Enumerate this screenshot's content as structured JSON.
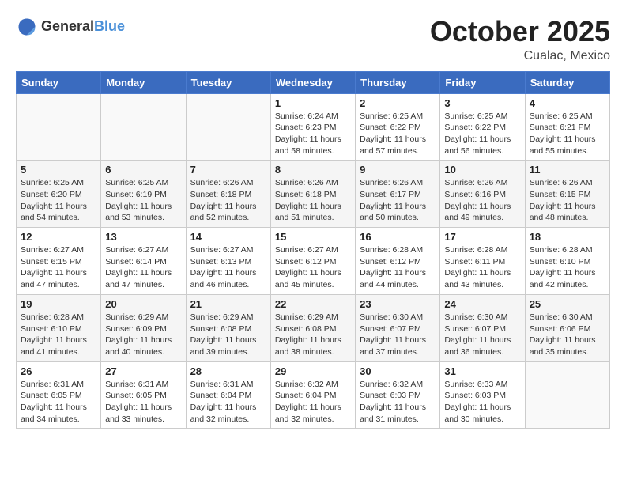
{
  "logo": {
    "text_general": "General",
    "text_blue": "Blue"
  },
  "title": {
    "month_year": "October 2025",
    "location": "Cualac, Mexico"
  },
  "weekdays": [
    "Sunday",
    "Monday",
    "Tuesday",
    "Wednesday",
    "Thursday",
    "Friday",
    "Saturday"
  ],
  "weeks": [
    [
      {
        "day": "",
        "sunrise": "",
        "sunset": "",
        "daylight": ""
      },
      {
        "day": "",
        "sunrise": "",
        "sunset": "",
        "daylight": ""
      },
      {
        "day": "",
        "sunrise": "",
        "sunset": "",
        "daylight": ""
      },
      {
        "day": "1",
        "sunrise": "Sunrise: 6:24 AM",
        "sunset": "Sunset: 6:23 PM",
        "daylight": "Daylight: 11 hours and 58 minutes."
      },
      {
        "day": "2",
        "sunrise": "Sunrise: 6:25 AM",
        "sunset": "Sunset: 6:22 PM",
        "daylight": "Daylight: 11 hours and 57 minutes."
      },
      {
        "day": "3",
        "sunrise": "Sunrise: 6:25 AM",
        "sunset": "Sunset: 6:22 PM",
        "daylight": "Daylight: 11 hours and 56 minutes."
      },
      {
        "day": "4",
        "sunrise": "Sunrise: 6:25 AM",
        "sunset": "Sunset: 6:21 PM",
        "daylight": "Daylight: 11 hours and 55 minutes."
      }
    ],
    [
      {
        "day": "5",
        "sunrise": "Sunrise: 6:25 AM",
        "sunset": "Sunset: 6:20 PM",
        "daylight": "Daylight: 11 hours and 54 minutes."
      },
      {
        "day": "6",
        "sunrise": "Sunrise: 6:25 AM",
        "sunset": "Sunset: 6:19 PM",
        "daylight": "Daylight: 11 hours and 53 minutes."
      },
      {
        "day": "7",
        "sunrise": "Sunrise: 6:26 AM",
        "sunset": "Sunset: 6:18 PM",
        "daylight": "Daylight: 11 hours and 52 minutes."
      },
      {
        "day": "8",
        "sunrise": "Sunrise: 6:26 AM",
        "sunset": "Sunset: 6:18 PM",
        "daylight": "Daylight: 11 hours and 51 minutes."
      },
      {
        "day": "9",
        "sunrise": "Sunrise: 6:26 AM",
        "sunset": "Sunset: 6:17 PM",
        "daylight": "Daylight: 11 hours and 50 minutes."
      },
      {
        "day": "10",
        "sunrise": "Sunrise: 6:26 AM",
        "sunset": "Sunset: 6:16 PM",
        "daylight": "Daylight: 11 hours and 49 minutes."
      },
      {
        "day": "11",
        "sunrise": "Sunrise: 6:26 AM",
        "sunset": "Sunset: 6:15 PM",
        "daylight": "Daylight: 11 hours and 48 minutes."
      }
    ],
    [
      {
        "day": "12",
        "sunrise": "Sunrise: 6:27 AM",
        "sunset": "Sunset: 6:15 PM",
        "daylight": "Daylight: 11 hours and 47 minutes."
      },
      {
        "day": "13",
        "sunrise": "Sunrise: 6:27 AM",
        "sunset": "Sunset: 6:14 PM",
        "daylight": "Daylight: 11 hours and 47 minutes."
      },
      {
        "day": "14",
        "sunrise": "Sunrise: 6:27 AM",
        "sunset": "Sunset: 6:13 PM",
        "daylight": "Daylight: 11 hours and 46 minutes."
      },
      {
        "day": "15",
        "sunrise": "Sunrise: 6:27 AM",
        "sunset": "Sunset: 6:12 PM",
        "daylight": "Daylight: 11 hours and 45 minutes."
      },
      {
        "day": "16",
        "sunrise": "Sunrise: 6:28 AM",
        "sunset": "Sunset: 6:12 PM",
        "daylight": "Daylight: 11 hours and 44 minutes."
      },
      {
        "day": "17",
        "sunrise": "Sunrise: 6:28 AM",
        "sunset": "Sunset: 6:11 PM",
        "daylight": "Daylight: 11 hours and 43 minutes."
      },
      {
        "day": "18",
        "sunrise": "Sunrise: 6:28 AM",
        "sunset": "Sunset: 6:10 PM",
        "daylight": "Daylight: 11 hours and 42 minutes."
      }
    ],
    [
      {
        "day": "19",
        "sunrise": "Sunrise: 6:28 AM",
        "sunset": "Sunset: 6:10 PM",
        "daylight": "Daylight: 11 hours and 41 minutes."
      },
      {
        "day": "20",
        "sunrise": "Sunrise: 6:29 AM",
        "sunset": "Sunset: 6:09 PM",
        "daylight": "Daylight: 11 hours and 40 minutes."
      },
      {
        "day": "21",
        "sunrise": "Sunrise: 6:29 AM",
        "sunset": "Sunset: 6:08 PM",
        "daylight": "Daylight: 11 hours and 39 minutes."
      },
      {
        "day": "22",
        "sunrise": "Sunrise: 6:29 AM",
        "sunset": "Sunset: 6:08 PM",
        "daylight": "Daylight: 11 hours and 38 minutes."
      },
      {
        "day": "23",
        "sunrise": "Sunrise: 6:30 AM",
        "sunset": "Sunset: 6:07 PM",
        "daylight": "Daylight: 11 hours and 37 minutes."
      },
      {
        "day": "24",
        "sunrise": "Sunrise: 6:30 AM",
        "sunset": "Sunset: 6:07 PM",
        "daylight": "Daylight: 11 hours and 36 minutes."
      },
      {
        "day": "25",
        "sunrise": "Sunrise: 6:30 AM",
        "sunset": "Sunset: 6:06 PM",
        "daylight": "Daylight: 11 hours and 35 minutes."
      }
    ],
    [
      {
        "day": "26",
        "sunrise": "Sunrise: 6:31 AM",
        "sunset": "Sunset: 6:05 PM",
        "daylight": "Daylight: 11 hours and 34 minutes."
      },
      {
        "day": "27",
        "sunrise": "Sunrise: 6:31 AM",
        "sunset": "Sunset: 6:05 PM",
        "daylight": "Daylight: 11 hours and 33 minutes."
      },
      {
        "day": "28",
        "sunrise": "Sunrise: 6:31 AM",
        "sunset": "Sunset: 6:04 PM",
        "daylight": "Daylight: 11 hours and 32 minutes."
      },
      {
        "day": "29",
        "sunrise": "Sunrise: 6:32 AM",
        "sunset": "Sunset: 6:04 PM",
        "daylight": "Daylight: 11 hours and 32 minutes."
      },
      {
        "day": "30",
        "sunrise": "Sunrise: 6:32 AM",
        "sunset": "Sunset: 6:03 PM",
        "daylight": "Daylight: 11 hours and 31 minutes."
      },
      {
        "day": "31",
        "sunrise": "Sunrise: 6:33 AM",
        "sunset": "Sunset: 6:03 PM",
        "daylight": "Daylight: 11 hours and 30 minutes."
      },
      {
        "day": "",
        "sunrise": "",
        "sunset": "",
        "daylight": ""
      }
    ]
  ]
}
